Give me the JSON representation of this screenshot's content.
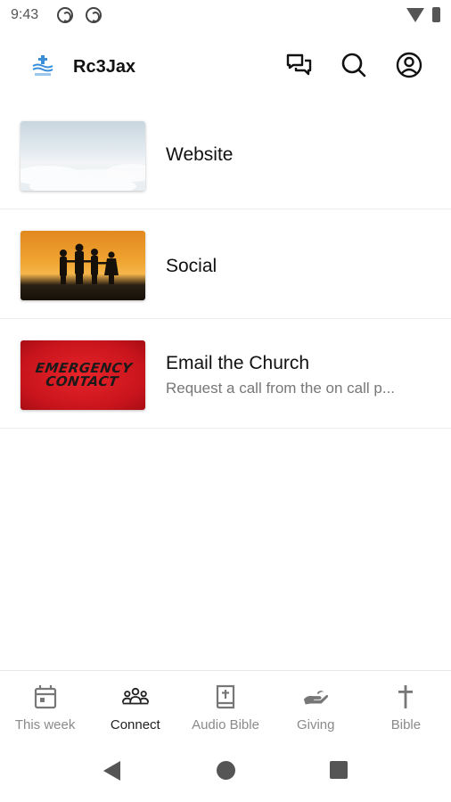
{
  "status_bar": {
    "time": "9:43",
    "icons": [
      "at-sign-icon",
      "at-sign-icon",
      "wifi-icon",
      "battery-icon"
    ]
  },
  "app_bar": {
    "title": "Rc3Jax",
    "logo": "church-logo",
    "actions": [
      "chat-icon",
      "search-icon",
      "account-icon"
    ]
  },
  "list": {
    "items": [
      {
        "title": "Website",
        "subtitle": ""
      },
      {
        "title": "Social",
        "subtitle": ""
      },
      {
        "title": "Email the Church",
        "subtitle": "Request a call from the on call p..."
      }
    ],
    "emergency_thumb_text": "EMERGENCY CONTACT"
  },
  "bottom_nav": {
    "active": "Connect",
    "items": [
      {
        "label": "This week",
        "icon": "calendar-icon"
      },
      {
        "label": "Connect",
        "icon": "group-icon"
      },
      {
        "label": "Audio Bible",
        "icon": "bible-book-icon"
      },
      {
        "label": "Giving",
        "icon": "giving-hand-icon"
      },
      {
        "label": "Bible",
        "icon": "cross-icon"
      }
    ]
  },
  "colors": {
    "accent_active": "#222222",
    "inactive": "#8a8a8a",
    "logo_blue": "#3a8ed8"
  }
}
